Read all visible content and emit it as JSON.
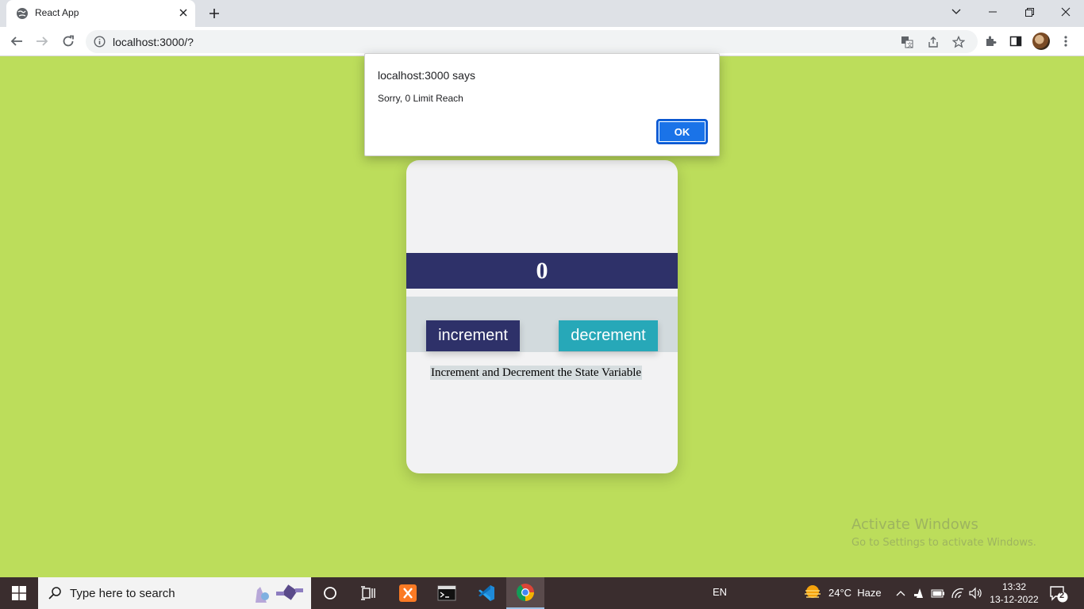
{
  "browser": {
    "tab_title": "React App",
    "url": "localhost:3000/?"
  },
  "app": {
    "counter_value": "0",
    "increment_label": "increment",
    "decrement_label": "decrement",
    "caption": "Increment and Decrement the State Variable"
  },
  "alert": {
    "title": "localhost:3000 says",
    "message": "Sorry, 0 Limit Reach",
    "ok_label": "OK"
  },
  "watermark": {
    "title": "Activate Windows",
    "subtitle": "Go to Settings to activate Windows."
  },
  "taskbar": {
    "search_placeholder": "Type here to search",
    "language": "EN",
    "weather": "24°C  Haze",
    "time": "13:32",
    "date": "13-12-2022",
    "notification_count": "2"
  },
  "colors": {
    "page_background": "#bcdd5b",
    "counter_bar": "#2e3169",
    "increment_button": "#2e3169",
    "decrement_button": "#27a8b8",
    "alert_ok": "#1a73e8"
  },
  "icons": [
    "globe-icon",
    "close-icon",
    "plus-icon",
    "chevron-down-icon",
    "minimize-icon",
    "restore-icon",
    "back-icon",
    "forward-icon",
    "reload-icon",
    "info-icon",
    "translate-icon",
    "share-icon",
    "star-icon",
    "extensions-icon",
    "sidepanel-icon",
    "menu-icon",
    "windows-icon",
    "search-icon",
    "cortana-icon",
    "taskview-icon",
    "xampp-icon",
    "terminal-icon",
    "vscode-icon",
    "chrome-icon",
    "weather-icon",
    "wifi-icon",
    "volume-icon",
    "notification-icon"
  ]
}
